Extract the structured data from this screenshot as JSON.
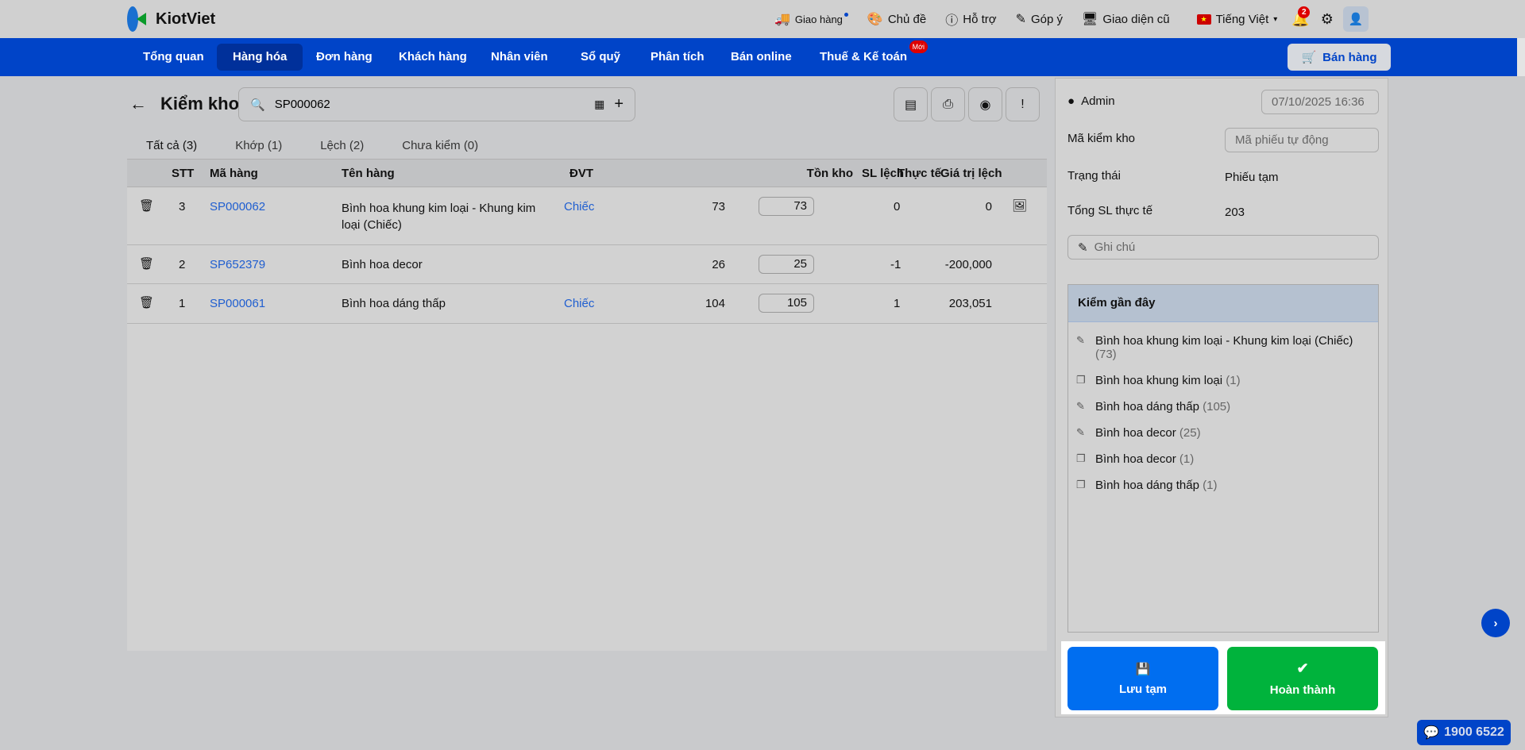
{
  "header": {
    "brand": "KiotViet",
    "tools": [
      "Giao hàng",
      "Chủ đề",
      "Hỗ trợ",
      "Góp ý",
      "Giao diện cũ"
    ],
    "language": "Tiếng Việt",
    "notifications": "2"
  },
  "nav": {
    "items": [
      "Tổng quan",
      "Hàng hóa",
      "Đơn hàng",
      "Khách hàng",
      "Nhân viên",
      "Sổ quỹ",
      "Phân tích",
      "Bán online",
      "Thuế & Kế toán"
    ],
    "new_badge": "Mới",
    "sell": "Bán hàng"
  },
  "page": {
    "title": "Kiểm kho",
    "search_value": "SP000062"
  },
  "tabs": [
    "Tất cả (3)",
    "Khớp (1)",
    "Lệch (2)",
    "Chưa kiểm (0)"
  ],
  "table": {
    "headers": [
      "STT",
      "Mã hàng",
      "Tên hàng",
      "ĐVT",
      "Tồn kho",
      "Thực tế",
      "SL lệch",
      "Giá trị lệch"
    ],
    "rows": [
      {
        "stt": "3",
        "code": "SP000062",
        "name": "Bình hoa khung kim loại - Khung kim loại (Chiếc)",
        "unit": "Chiếc",
        "stock": "73",
        "actual": "73",
        "diff": "0",
        "value": "0"
      },
      {
        "stt": "2",
        "code": "SP652379",
        "name": "Bình hoa decor",
        "unit": "",
        "stock": "26",
        "actual": "25",
        "diff": "-1",
        "value": "-200,000"
      },
      {
        "stt": "1",
        "code": "SP000061",
        "name": "Bình hoa dáng thấp",
        "unit": "Chiếc",
        "stock": "104",
        "actual": "105",
        "diff": "1",
        "value": "203,051"
      }
    ]
  },
  "side": {
    "user": "Admin",
    "datetime": "07/10/2025 16:36",
    "code_label": "Mã kiểm kho",
    "code_placeholder": "Mã phiếu tự động",
    "status_label": "Trạng thái",
    "status": "Phiếu tạm",
    "total_label": "Tổng SL thực tế",
    "total": "203",
    "note_placeholder": "Ghi chú",
    "recent_title": "Kiểm gần đây",
    "recent": [
      {
        "icon": "pencil",
        "name": "Bình hoa khung kim loại - Khung kim loại (Chiếc)",
        "count": "(73)"
      },
      {
        "icon": "copy",
        "name": "Bình hoa khung kim loại",
        "count": "(1)"
      },
      {
        "icon": "pencil",
        "name": "Bình hoa dáng thấp",
        "count": "(105)"
      },
      {
        "icon": "pencil",
        "name": "Bình hoa decor",
        "count": "(25)"
      },
      {
        "icon": "copy",
        "name": "Bình hoa decor",
        "count": "(1)"
      },
      {
        "icon": "copy",
        "name": "Bình hoa dáng thấp",
        "count": "(1)"
      }
    ]
  },
  "footer": {
    "save": "Lưu tạm",
    "complete": "Hoàn thành",
    "hotline": "1900 6522"
  },
  "colors": {
    "nav": "#0044c8",
    "save": "#006ef0",
    "complete": "#00b33c"
  }
}
